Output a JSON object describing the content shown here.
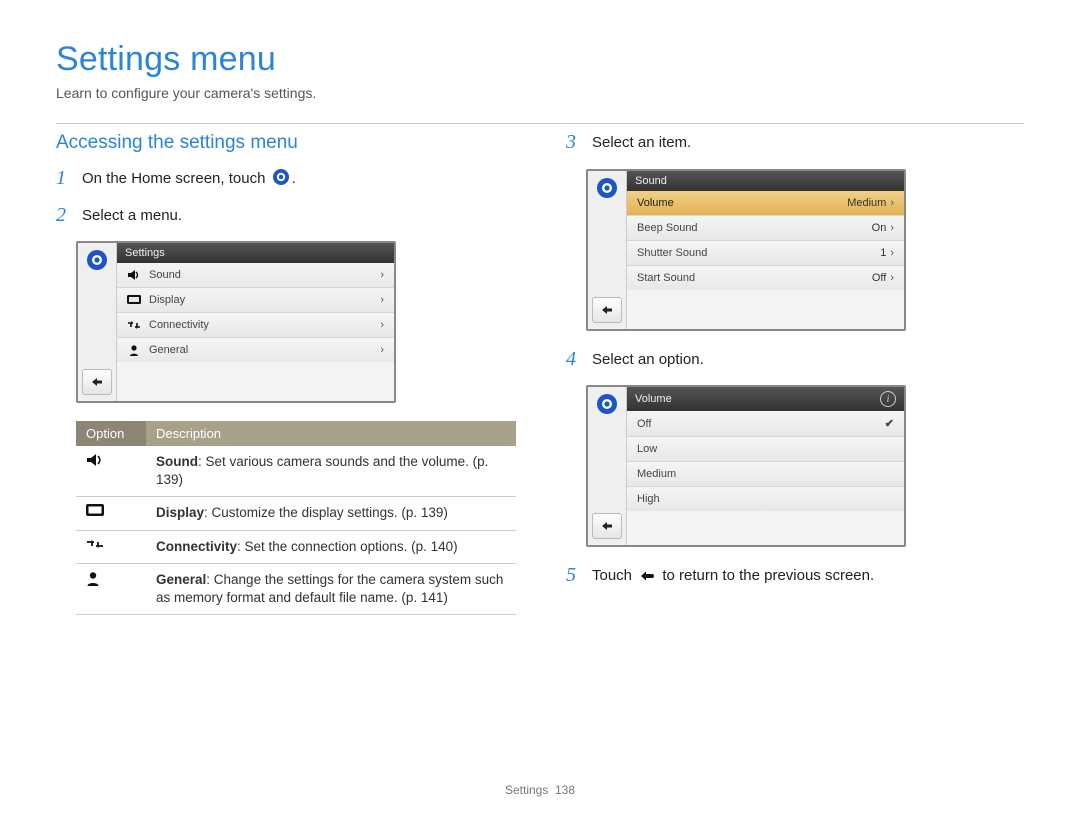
{
  "title": "Settings menu",
  "subtitle": "Learn to configure your camera's settings.",
  "section_heading": "Accessing the settings menu",
  "footer": {
    "label": "Settings",
    "page": "138"
  },
  "steps": {
    "s1": {
      "num": "1",
      "text_a": "On the Home screen, touch ",
      "text_b": "."
    },
    "s2": {
      "num": "2",
      "text": "Select a menu."
    },
    "s3": {
      "num": "3",
      "text": "Select an item."
    },
    "s4": {
      "num": "4",
      "text": "Select an option."
    },
    "s5": {
      "num": "5",
      "text_a": "Touch ",
      "text_b": " to return to the previous screen."
    }
  },
  "lcd_settings": {
    "header": "Settings",
    "rows": [
      {
        "label": "Sound"
      },
      {
        "label": "Display"
      },
      {
        "label": "Connectivity"
      },
      {
        "label": "General"
      }
    ]
  },
  "lcd_sound": {
    "header": "Sound",
    "rows": [
      {
        "label": "Volume",
        "value": "Medium",
        "selected": true
      },
      {
        "label": "Beep Sound",
        "value": "On"
      },
      {
        "label": "Shutter Sound",
        "value": "1"
      },
      {
        "label": "Start Sound",
        "value": "Off"
      }
    ]
  },
  "lcd_volume": {
    "header": "Volume",
    "rows": [
      {
        "label": "Off",
        "checked": true
      },
      {
        "label": "Low"
      },
      {
        "label": "Medium"
      },
      {
        "label": "High"
      }
    ]
  },
  "opts_table": {
    "headers": {
      "c1": "Option",
      "c2": "Description"
    },
    "rows": [
      {
        "title": "Sound",
        "desc": ": Set various camera sounds and the volume. (p. 139)"
      },
      {
        "title": "Display",
        "desc": ": Customize the display settings. (p. 139)"
      },
      {
        "title": "Connectivity",
        "desc": ": Set the connection options. (p. 140)"
      },
      {
        "title": "General",
        "desc": ": Change the settings for the camera system such as memory format and default file name. (p. 141)"
      }
    ]
  }
}
